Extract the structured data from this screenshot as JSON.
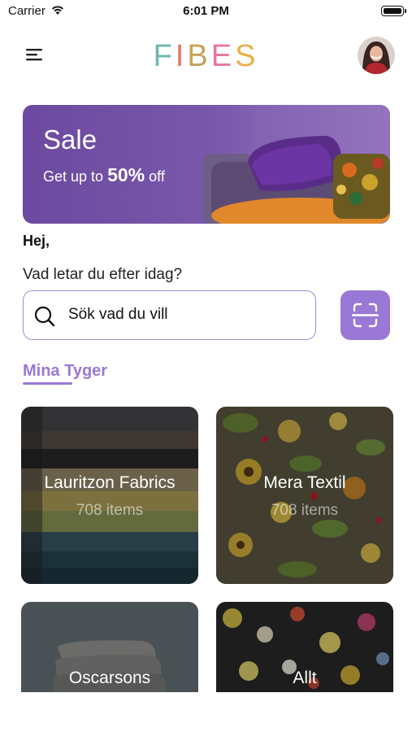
{
  "status_bar": {
    "carrier": "Carrier",
    "time": "6:01 PM"
  },
  "header": {
    "logo_letters": [
      "F",
      "I",
      "B",
      "E",
      "S"
    ],
    "logo_colors": [
      "#6fb7b0",
      "#e07a6a",
      "#c8a25a",
      "#e4789a",
      "#e9b04a"
    ],
    "menu_icon": "hamburger-icon",
    "avatar_icon": "user-avatar"
  },
  "banner": {
    "title": "Sale",
    "subtitle_prefix": "Get up to",
    "subtitle_highlight": "50%",
    "subtitle_suffix": "off"
  },
  "greeting": "Hej,",
  "question": "Vad letar du efter idag?",
  "search": {
    "placeholder": "Sök vad du vill",
    "scan_icon": "scan-icon"
  },
  "section": {
    "label": "Mina Tyger"
  },
  "cards": [
    {
      "title": "Lauritzon Fabrics",
      "count": "708 items"
    },
    {
      "title": "Mera Textil",
      "count": "708 items"
    },
    {
      "title": "Oscarsons"
    },
    {
      "title": "Allt"
    }
  ],
  "colors": {
    "accent": "#9a78d6",
    "banner": "#6b4aa0"
  }
}
